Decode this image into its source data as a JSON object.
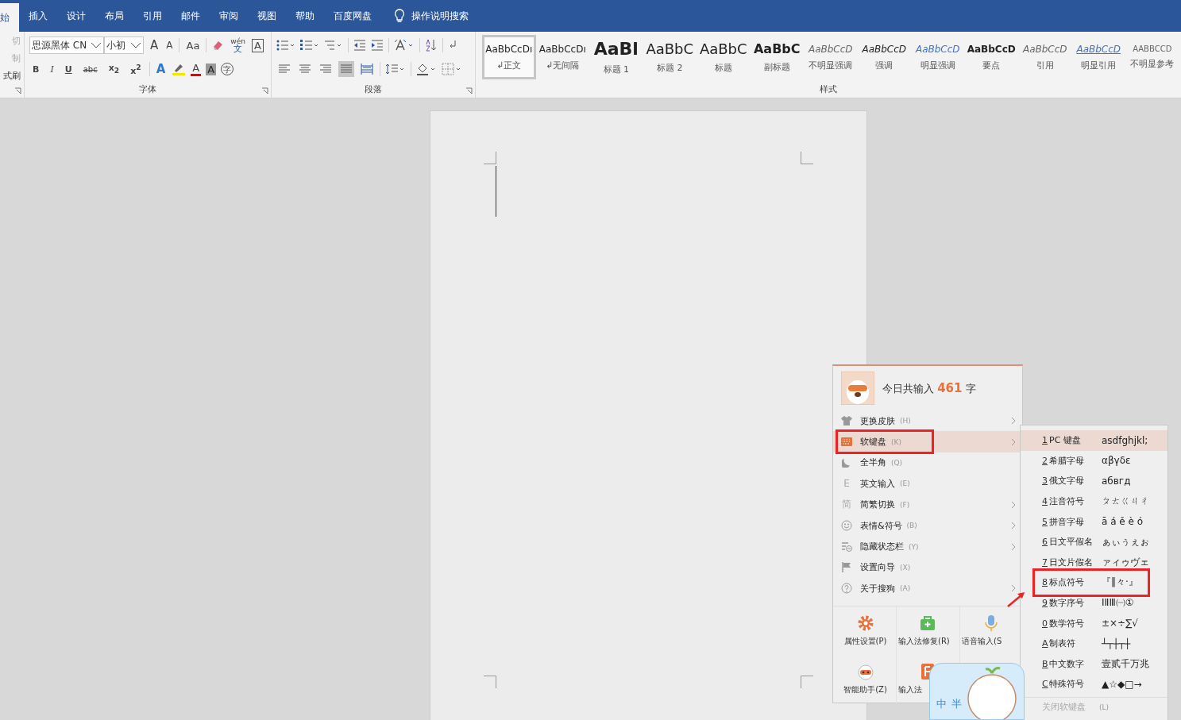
{
  "tabs": [
    {
      "label": "始",
      "selected": true
    },
    {
      "label": "插入",
      "selected": false
    },
    {
      "label": "设计",
      "selected": false
    },
    {
      "label": "布局",
      "selected": false
    },
    {
      "label": "引用",
      "selected": false
    },
    {
      "label": "邮件",
      "selected": false
    },
    {
      "label": "审阅",
      "selected": false
    },
    {
      "label": "视图",
      "selected": false
    },
    {
      "label": "帮助",
      "selected": false
    },
    {
      "label": "百度网盘",
      "selected": false
    }
  ],
  "tell_me": "操作说明搜索",
  "clipboard": {
    "items": [
      {
        "label": "切",
        "disabled": true
      },
      {
        "label": "制",
        "disabled": true
      },
      {
        "label": "式刷",
        "disabled": false
      }
    ]
  },
  "font": {
    "name": "思源黑体 CN",
    "size": "小初",
    "grow": "A",
    "shrink": "A",
    "case": "Aa",
    "phonetic_top": "wén",
    "phonetic_bottom": "文",
    "border_char": "A",
    "format_buttons": [
      {
        "text": "B",
        "kind": "bold"
      },
      {
        "text": "I",
        "kind": "italic"
      },
      {
        "text": "U",
        "kind": "underline"
      },
      {
        "text": "abc",
        "kind": "strike"
      },
      {
        "text": "x$_{2}$",
        "kind": "sub"
      },
      {
        "text": "x$^{2}$",
        "kind": "sup"
      }
    ],
    "effect_char": "A",
    "color_char": "A",
    "shade_char": "A",
    "enclose_char": "字",
    "label": "字体"
  },
  "paragraph": {
    "label": "段落",
    "alignments": [
      {
        "kind": "left",
        "selected": false
      },
      {
        "kind": "center",
        "selected": false
      },
      {
        "kind": "right",
        "selected": false
      },
      {
        "kind": "justify",
        "selected": true
      },
      {
        "kind": "distributed",
        "selected": false
      }
    ]
  },
  "styles": {
    "label": "样式",
    "items": [
      {
        "preview": "AaBbCcDı",
        "name": "正文",
        "mark": "↲",
        "kind": "normal",
        "selected": true
      },
      {
        "preview": "AaBbCcDı",
        "name": "无间隔",
        "mark": "↲",
        "kind": "normal",
        "selected": false
      },
      {
        "preview": "AaBl",
        "name": "标题 1",
        "kind": "h1",
        "selected": false
      },
      {
        "preview": "AaBbC",
        "name": "标题 2",
        "kind": "h2",
        "selected": false
      },
      {
        "preview": "AaBbC",
        "name": "标题",
        "kind": "title",
        "selected": false
      },
      {
        "preview": "AaBbC",
        "name": "副标题",
        "kind": "subtitle",
        "selected": false
      },
      {
        "preview": "AaBbCcD",
        "name": "不明显强调",
        "kind": "subtle",
        "selected": false
      },
      {
        "preview": "AaBbCcD",
        "name": "强调",
        "kind": "emphasis",
        "selected": false
      },
      {
        "preview": "AaBbCcD",
        "name": "明显强调",
        "kind": "intense",
        "selected": false
      },
      {
        "preview": "AaBbCcD",
        "name": "要点",
        "kind": "strong",
        "selected": false
      },
      {
        "preview": "AaBbCcD",
        "name": "引用",
        "kind": "quote",
        "selected": false
      },
      {
        "preview": "AaBbCcD",
        "name": "明显引用",
        "kind": "intense_quote",
        "selected": false
      },
      {
        "preview": "AABBCCD",
        "name": "不明显参考",
        "kind": "reference",
        "selected": false
      }
    ]
  },
  "ime_menu": {
    "greeting_prefix": "今日共输入",
    "count": "461",
    "greeting_suffix": "字",
    "items": [
      {
        "kind": "shirt",
        "label": "更换皮肤",
        "shortcut": "(H)",
        "submenu": true,
        "selected": false,
        "annotated": false
      },
      {
        "kind": "keyboard",
        "label": "软键盘",
        "shortcut": "(K)",
        "submenu": true,
        "selected": true,
        "annotated": true
      },
      {
        "kind": "moon",
        "label": "全半角",
        "shortcut": "(Q)",
        "submenu": false,
        "selected": false,
        "annotated": false
      },
      {
        "kind": "glyph",
        "glyph": "E",
        "label": "英文输入",
        "shortcut": "(E)",
        "submenu": false,
        "selected": false,
        "annotated": false
      },
      {
        "kind": "glyph",
        "glyph": "简",
        "label": "简繁切换",
        "shortcut": "(F)",
        "submenu": true,
        "selected": false,
        "annotated": false
      },
      {
        "kind": "smile",
        "label": "表情&符号",
        "shortcut": "(B)",
        "submenu": true,
        "selected": false,
        "annotated": false
      },
      {
        "kind": "hide",
        "label": "隐藏状态栏",
        "shortcut": "(Y)",
        "submenu": true,
        "selected": false,
        "annotated": false
      },
      {
        "kind": "flag",
        "label": "设置向导",
        "shortcut": "(X)",
        "submenu": false,
        "selected": false,
        "annotated": false
      },
      {
        "kind": "help",
        "label": "关于搜狗",
        "shortcut": "(A)",
        "submenu": true,
        "selected": false,
        "annotated": false
      }
    ],
    "tools": [
      {
        "kind": "gear",
        "label": "属性设置",
        "shortcut": "(P)"
      },
      {
        "kind": "repair",
        "label": "输入法修复",
        "shortcut": "(R)"
      },
      {
        "kind": "mic",
        "label": "语音输入",
        "shortcut": "(S"
      },
      {
        "kind": "robot",
        "label": "智能助手",
        "shortcut": "(Z)"
      },
      {
        "kind": "book",
        "label": "输入法"
      }
    ]
  },
  "soft_keyboard_menu": {
    "items": [
      {
        "key": "1",
        "label": "PC 键盘",
        "sample": "asdfghjkl;",
        "selected": true,
        "annotated": false
      },
      {
        "key": "2",
        "label": "希腊字母",
        "sample": "αβγδε",
        "selected": false,
        "annotated": false
      },
      {
        "key": "3",
        "label": "俄文字母",
        "sample": "абвгд",
        "selected": false,
        "annotated": false
      },
      {
        "key": "4",
        "label": "注音符号",
        "sample": "ㄆㄊㄍㄐㄔ",
        "selected": false,
        "annotated": false
      },
      {
        "key": "5",
        "label": "拼音字母",
        "sample": "ā á ě è ó",
        "selected": false,
        "annotated": false
      },
      {
        "key": "6",
        "label": "日文平假名",
        "sample": "ぁぃぅぇぉ",
        "selected": false,
        "annotated": false
      },
      {
        "key": "7",
        "label": "日文片假名",
        "sample": "ァィゥヴェ",
        "selected": false,
        "annotated": false
      },
      {
        "key": "8",
        "label": "标点符号",
        "sample": "『‖々·』",
        "selected": false,
        "annotated": true
      },
      {
        "key": "9",
        "label": "数字序号",
        "sample": "ⅠⅡⅢ㈠①",
        "selected": false,
        "annotated": false
      },
      {
        "key": "0",
        "label": "数学符号",
        "sample": "±×÷∑√",
        "selected": false,
        "annotated": false
      },
      {
        "key": "A",
        "label": "制表符",
        "sample": "┴┬┼┬┼",
        "selected": false,
        "annotated": false
      },
      {
        "key": "B",
        "label": "中文数字",
        "sample": "壹贰千万兆",
        "selected": false,
        "annotated": false
      },
      {
        "key": "C",
        "label": "特殊符号",
        "sample": "▲☆◆□→",
        "selected": false,
        "annotated": false
      }
    ],
    "close_label": "关闭软键盘",
    "close_shortcut": "(L)",
    "close_disabled": true
  },
  "ime_status": {
    "mode": "中",
    "width": "半"
  }
}
